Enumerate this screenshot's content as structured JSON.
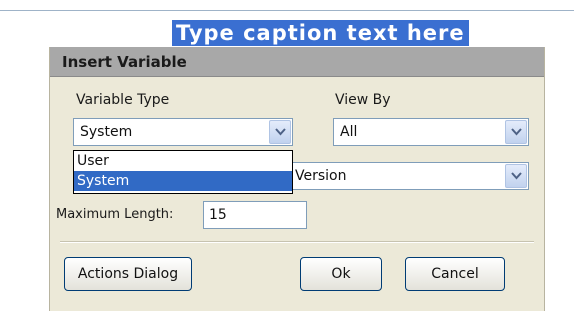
{
  "caption": "Type caption text here",
  "dialog": {
    "title": "Insert Variable",
    "variable_type": {
      "label": "Variable Type",
      "value": "System",
      "options": [
        "User",
        "System"
      ],
      "highlighted": "System"
    },
    "view_by": {
      "label": "View By",
      "value": "All"
    },
    "variable": {
      "value_visible": "Version"
    },
    "max_length": {
      "label": "Maximum Length:",
      "value": "15"
    },
    "buttons": {
      "actions": "Actions Dialog",
      "ok": "Ok",
      "cancel": "Cancel"
    }
  },
  "colors": {
    "caption_bg": "#3a6fd1",
    "title_bar": "#a8a8a8",
    "dialog_bg": "#ece9d8",
    "selection": "#316ac5"
  }
}
